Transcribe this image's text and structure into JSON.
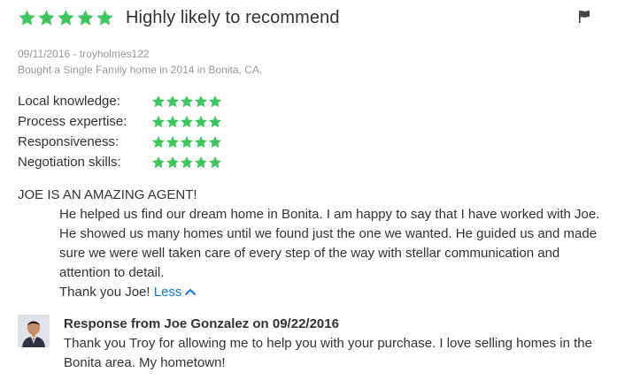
{
  "review": {
    "headline": "Highly likely to recommend",
    "overall_rating": 5,
    "date_user": "09/11/2016 - troyholmes122",
    "transaction": "Bought a Single Family home in 2014 in Bonita, CA.",
    "ratings": [
      {
        "label": "Local knowledge:",
        "stars": 5
      },
      {
        "label": "Process expertise:",
        "stars": 5
      },
      {
        "label": "Responsiveness:",
        "stars": 5
      },
      {
        "label": "Negotiation skills:",
        "stars": 5
      }
    ],
    "body": {
      "line1": "JOE IS AN AMAZING AGENT!",
      "paragraph": "He helped us find our dream home in Bonita. I am happy to say that I have worked with Joe. He showed us many homes until we found just the one we wanted. He guided us and made sure we were well taken care of every step of the way with stellar communication and attention to detail.",
      "closing": "Thank you Joe!",
      "less_label": "Less"
    },
    "response": {
      "title": "Response from Joe Gonzalez on 09/22/2016",
      "text": "Thank you Troy for allowing me to help you with your purchase. I love selling homes in the Bonita area. My hometown!"
    }
  },
  "icons": {
    "star": "star-icon",
    "flag": "flag-icon",
    "chevron": "chevron-up-icon",
    "avatar": "agent-avatar"
  },
  "colors": {
    "star": "#3dc55e",
    "link": "#1277e1",
    "text": "#333333",
    "meta": "#999999"
  }
}
